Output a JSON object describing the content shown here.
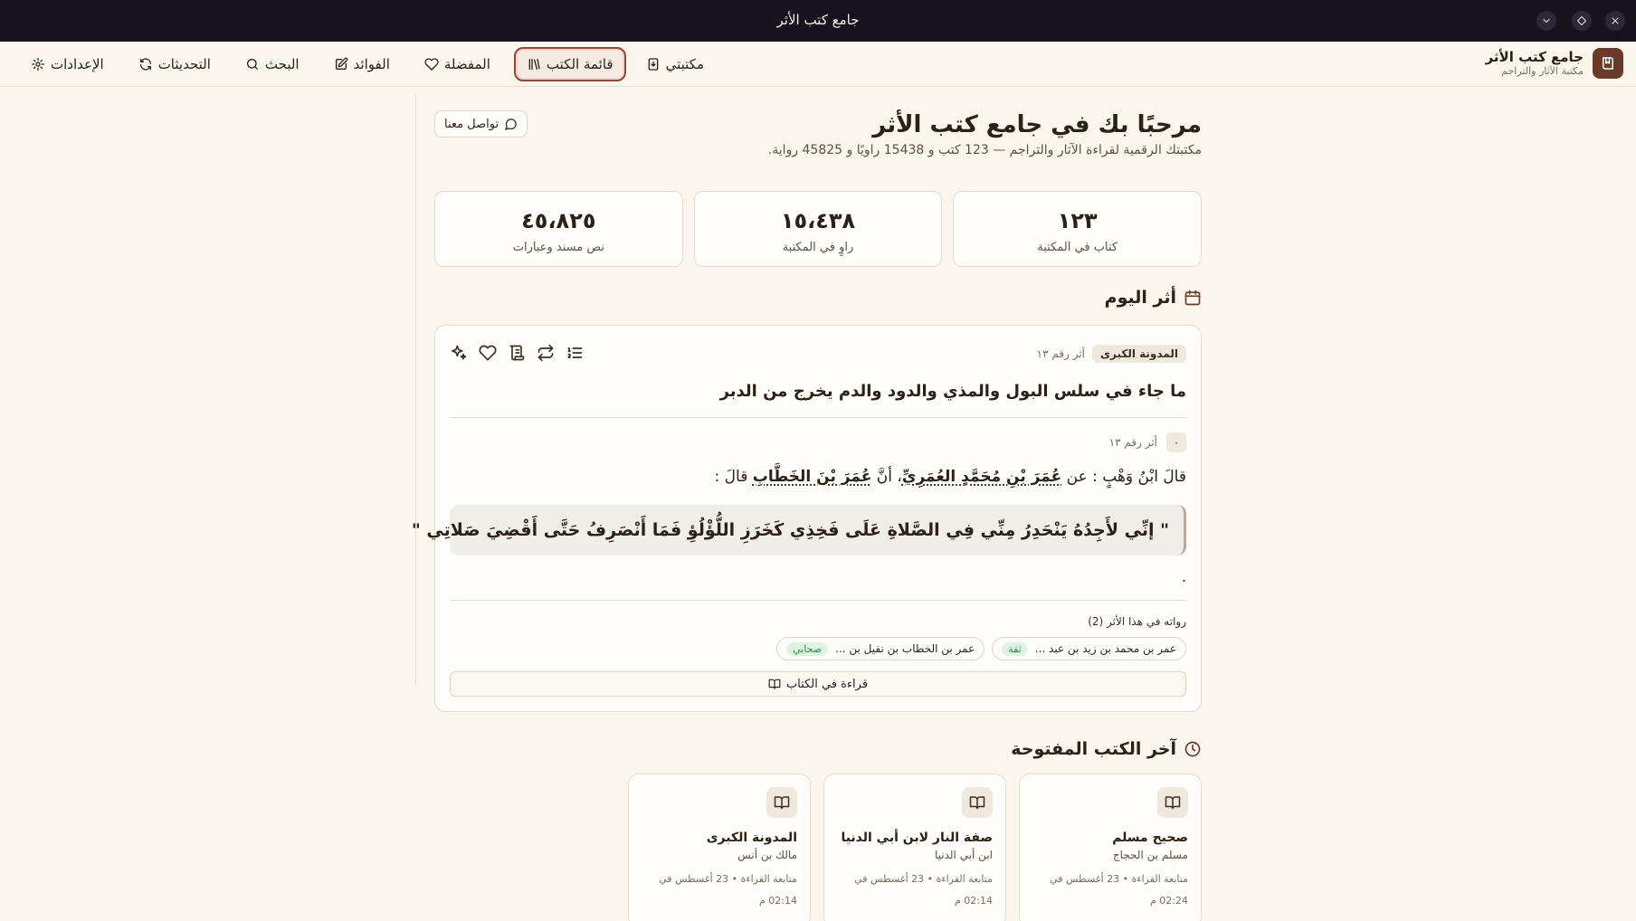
{
  "window": {
    "title": "جامع كتب الأثر"
  },
  "brand": {
    "name": "جامع كتب الأثر",
    "subtitle": "مكتبة الآثار والتراجم"
  },
  "nav": [
    {
      "label": "مكتبتي",
      "icon": "book-download-icon",
      "active": false
    },
    {
      "label": "قائمة الكتب",
      "icon": "library-icon",
      "active": true
    },
    {
      "label": "المفضلة",
      "icon": "heart-icon",
      "active": false
    },
    {
      "label": "الفوائد",
      "icon": "notebook-pen-icon",
      "active": false
    },
    {
      "label": "البحث",
      "icon": "search-icon",
      "active": false
    },
    {
      "label": "التحديثات",
      "icon": "refresh-icon",
      "active": false
    },
    {
      "label": "الإعدادات",
      "icon": "gear-icon",
      "active": false
    }
  ],
  "welcome": {
    "title": "مرحبًا بك في جامع كتب الأثر",
    "subtitle": "مكتبتك الرقمية لقراءة الآثار والتراجم — 123 كتب و 15438 راويًا و 45825 رواية.",
    "contact_label": "تواصل معنا"
  },
  "stats": [
    {
      "value": "١٢٣",
      "label": "كتاب في المكتبة"
    },
    {
      "value": "١٥،٤٣٨",
      "label": "راوٍ في المكتبة"
    },
    {
      "value": "٤٥،٨٢٥",
      "label": "نص مسند وعبارات"
    }
  ],
  "athar_of_day": {
    "heading": "أثر اليوم",
    "book": "المدونة الكبرى",
    "number_label": "أثر رقم ١٣",
    "title": "ما جاء في سلس البول والمذي والدود والدم يخرج من الدبر",
    "index_chip": "٠",
    "isnad_prefix": "قالَ ابْنُ وَهْبٍ : عن",
    "rawi1": "عُمَرَ بْنِ مُحَمَّدٍ العُمَرِيِّ",
    "isnad_mid": "، أنَّ",
    "rawi2": "عُمَرَ بْنَ الخَطَّابِ",
    "isnad_suffix": "قالَ :",
    "matn": "\" إنِّي لأَجِدُهُ يَنْحَدِرُ مِنِّي فِي الصَّلاةِ عَلَى فَخِذِي كَخَرَزِ اللُّؤْلُؤِ فَمَا أَنْصَرِفُ حَتَّى أَقْضِيَ صَلاتِي \"",
    "tail": ".",
    "ruwat_label": "رواته في هذا الأثر (2)",
    "ruwat": [
      {
        "name": "عمر بن محمد بن زيد بن عبد ...",
        "grade": "ثقة"
      },
      {
        "name": "عمر بن الخطاب بن نفيل بن ...",
        "grade": "صحابي"
      }
    ],
    "read_label": "قراءة في الكتاب"
  },
  "recent": {
    "heading": "آخر الكتب المفتوحة",
    "items": [
      {
        "title": "صحيح مسلم",
        "author": "مسلم بن الحجاج",
        "time": "متابعة القراءة • 23 أغسطس في 02:24 م"
      },
      {
        "title": "صفة النار لابن أبي الدنيا",
        "author": "ابن أبي الدنيا",
        "time": "متابعة القراءة • 23 أغسطس في 02:14 م"
      },
      {
        "title": "المدونة الكبرى",
        "author": "مالك بن أنس",
        "time": "متابعة القراءة • 23 أغسطس في 02:14 م"
      }
    ]
  }
}
